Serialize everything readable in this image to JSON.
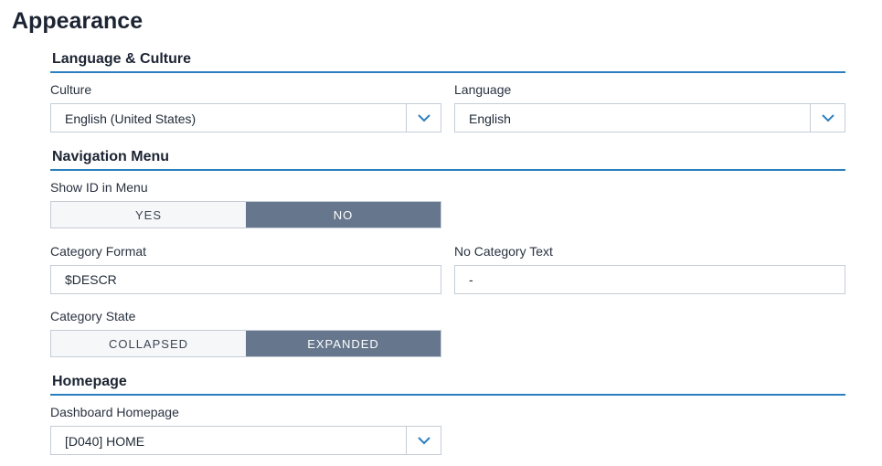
{
  "page": {
    "title": "Appearance"
  },
  "language_culture": {
    "header": "Language & Culture",
    "culture": {
      "label": "Culture",
      "value": "English (United States)"
    },
    "language": {
      "label": "Language",
      "value": "English"
    }
  },
  "navigation_menu": {
    "header": "Navigation Menu",
    "show_id": {
      "label": "Show ID in Menu",
      "options": [
        "YES",
        "NO"
      ],
      "selected": "NO"
    },
    "category_format": {
      "label": "Category Format",
      "value": "$DESCR"
    },
    "no_category_text": {
      "label": "No Category Text",
      "value": "-"
    },
    "category_state": {
      "label": "Category State",
      "options": [
        "COLLAPSED",
        "EXPANDED"
      ],
      "selected": "EXPANDED"
    }
  },
  "homepage": {
    "header": "Homepage",
    "dashboard_homepage": {
      "label": "Dashboard Homepage",
      "value": "[D040] HOME"
    }
  },
  "colors": {
    "accent": "#2b7fbf",
    "toggle_selected": "#66768c",
    "chevron": "#2b7fbf"
  },
  "icons": {
    "dropdown": "chevron-down-icon"
  }
}
